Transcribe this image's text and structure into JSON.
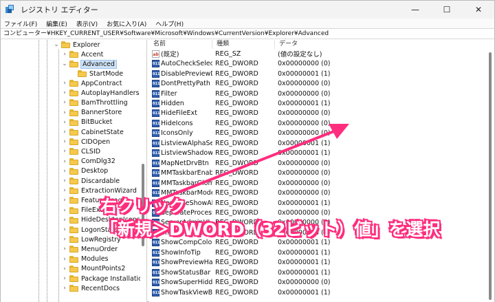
{
  "window": {
    "title": "レジストリ エディター",
    "controls": {
      "minimize": "—",
      "maximize": "☐",
      "close": "✕"
    }
  },
  "menu": [
    "ファイル(F)",
    "編集(E)",
    "表示(V)",
    "お気に入り(A)",
    "ヘルプ(H)"
  ],
  "address": "コンピューター¥HKEY_CURRENT_USER¥Software¥Microsoft¥Windows¥CurrentVersion¥Explorer¥Advanced",
  "tree": {
    "explorer": "Explorer",
    "accent": "Accent",
    "advanced": "Advanced",
    "startmode": "StartMode",
    "children": [
      "AppContract",
      "AutoplayHandlers",
      "BamThrottling",
      "BannerStore",
      "BitBucket",
      "CabinetState",
      "CIDOpen",
      "CLSID",
      "ComDlg32",
      "Desktop",
      "Discardable",
      "ExtractionWizard",
      "FeatureUsage",
      "FileExts",
      "HideDesktopIcons",
      "LogonStats",
      "LowRegistry",
      "MenuOrder",
      "Modules",
      "MountPoints2",
      "Package Installation",
      "RecentDocs"
    ]
  },
  "list": {
    "headers": {
      "name": "名前",
      "type": "種類",
      "data": "データ"
    },
    "rows": [
      {
        "icon": "string-value-icon",
        "name": "(既定)",
        "type": "REG_SZ",
        "data": "(値の設定なし)"
      },
      {
        "icon": "binary-value-icon",
        "name": "AutoCheckSelect",
        "type": "REG_DWORD",
        "data": "0x00000000 (0)"
      },
      {
        "icon": "binary-value-icon",
        "name": "DisablePreviewD...",
        "type": "REG_DWORD",
        "data": "0x00000001 (1)"
      },
      {
        "icon": "binary-value-icon",
        "name": "DontPrettyPath",
        "type": "REG_DWORD",
        "data": "0x00000000 (0)"
      },
      {
        "icon": "binary-value-icon",
        "name": "Filter",
        "type": "REG_DWORD",
        "data": "0x00000000 (0)"
      },
      {
        "icon": "binary-value-icon",
        "name": "Hidden",
        "type": "REG_DWORD",
        "data": "0x00000001 (1)"
      },
      {
        "icon": "binary-value-icon",
        "name": "HideFileExt",
        "type": "REG_DWORD",
        "data": "0x00000000 (0)"
      },
      {
        "icon": "binary-value-icon",
        "name": "HideIcons",
        "type": "REG_DWORD",
        "data": "0x00000000 (0)"
      },
      {
        "icon": "binary-value-icon",
        "name": "IconsOnly",
        "type": "REG_DWORD",
        "data": "0x00000000 (0)"
      },
      {
        "icon": "binary-value-icon",
        "name": "ListviewAlphaSel...",
        "type": "REG_DWORD",
        "data": "0x00000001 (1)"
      },
      {
        "icon": "binary-value-icon",
        "name": "ListviewShadow",
        "type": "REG_DWORD",
        "data": "0x00000001 (1)"
      },
      {
        "icon": "binary-value-icon",
        "name": "MapNetDrvBtn",
        "type": "REG_DWORD",
        "data": "0x00000000 (0)"
      },
      {
        "icon": "binary-value-icon",
        "name": "MMTaskbarEnabl...",
        "type": "REG_DWORD",
        "data": "0x00000000 (0)"
      },
      {
        "icon": "binary-value-icon",
        "name": "MMTaskbarGlom...",
        "type": "REG_DWORD",
        "data": "0x00000000 (0)"
      },
      {
        "icon": "binary-value-icon",
        "name": "MMTaskbarMode",
        "type": "REG_DWORD",
        "data": "0x00000000 (0)"
      },
      {
        "icon": "binary-value-icon",
        "name": "NavPaneShowAllFolders",
        "type": "REG_DWORD",
        "data": "0x00000001 (1)"
      },
      {
        "icon": "binary-value-icon",
        "name": "SeparateProcess",
        "type": "REG_DWORD",
        "data": "0x00000000 (0)"
      },
      {
        "icon": "binary-value-icon",
        "name": "ServerAdminUI",
        "type": "REG_DWORD",
        "data": "0x00000000 (0)"
      },
      {
        "icon": "binary-value-icon",
        "name": "ShellMigrationLevel",
        "type": "REG_DWORD",
        "data": "0x00000003 (3)"
      },
      {
        "icon": "binary-value-icon",
        "name": "ShowCompColor",
        "type": "REG_DWORD",
        "data": "0x00000001 (1)"
      },
      {
        "icon": "binary-value-icon",
        "name": "ShowInfoTip",
        "type": "REG_DWORD",
        "data": "0x00000001 (1)"
      },
      {
        "icon": "binary-value-icon",
        "name": "ShowPreviewHan...",
        "type": "REG_DWORD",
        "data": "0x00000001 (1)"
      },
      {
        "icon": "binary-value-icon",
        "name": "ShowStatusBar",
        "type": "REG_DWORD",
        "data": "0x00000001 (1)"
      },
      {
        "icon": "binary-value-icon",
        "name": "ShowSuperHidden",
        "type": "REG_DWORD",
        "data": "0x00000000 (0)"
      },
      {
        "icon": "binary-value-icon",
        "name": "ShowTaskViewBu...",
        "type": "REG_DWORD",
        "data": "0x00000001 (1)"
      }
    ]
  },
  "annotation": {
    "line1": "右クリック",
    "line2": "「新規＞DWORD（32ビット）値」を選択",
    "color": "#ff2d7e"
  }
}
